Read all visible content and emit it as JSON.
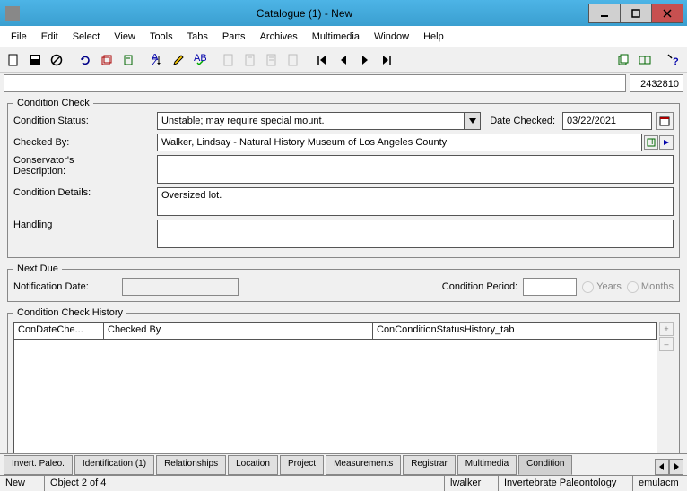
{
  "window": {
    "title": "Catalogue (1) - New"
  },
  "menu": [
    "File",
    "Edit",
    "Select",
    "View",
    "Tools",
    "Tabs",
    "Parts",
    "Archives",
    "Multimedia",
    "Window",
    "Help"
  ],
  "idbar": {
    "search_value": "",
    "record_number": "2432810"
  },
  "condition_check": {
    "legend": "Condition Check",
    "status_label": "Condition Status:",
    "status_value": "Unstable; may require special mount.",
    "date_checked_label": "Date Checked:",
    "date_checked_value": "03/22/2021",
    "checked_by_label": "Checked By:",
    "checked_by_value": "Walker, Lindsay - Natural History Museum of Los Angeles County",
    "conservator_label": "Conservator's\nDescription:",
    "conservator_value": "",
    "details_label": "Condition Details:",
    "details_value": "Oversized lot.",
    "handling_label": "Handling",
    "handling_value": ""
  },
  "next_due": {
    "legend": "Next Due",
    "notification_label": "Notification Date:",
    "notification_value": "",
    "period_label": "Condition Period:",
    "period_value": "",
    "years_label": "Years",
    "months_label": "Months"
  },
  "history": {
    "legend": "Condition Check History",
    "col1": "ConDateChe...",
    "col2": "Checked By",
    "col3": "ConConditionStatusHistory_tab"
  },
  "tabs": {
    "list": [
      "Invert. Paleo.",
      "Identification (1)",
      "Relationships",
      "Location",
      "Project",
      "Measurements",
      "Registrar",
      "Multimedia"
    ],
    "active": "Condition"
  },
  "status": {
    "mode": "New",
    "position": "Object 2 of 4",
    "user": "lwalker",
    "dept": "Invertebrate Paleontology",
    "db": "emulacm"
  }
}
